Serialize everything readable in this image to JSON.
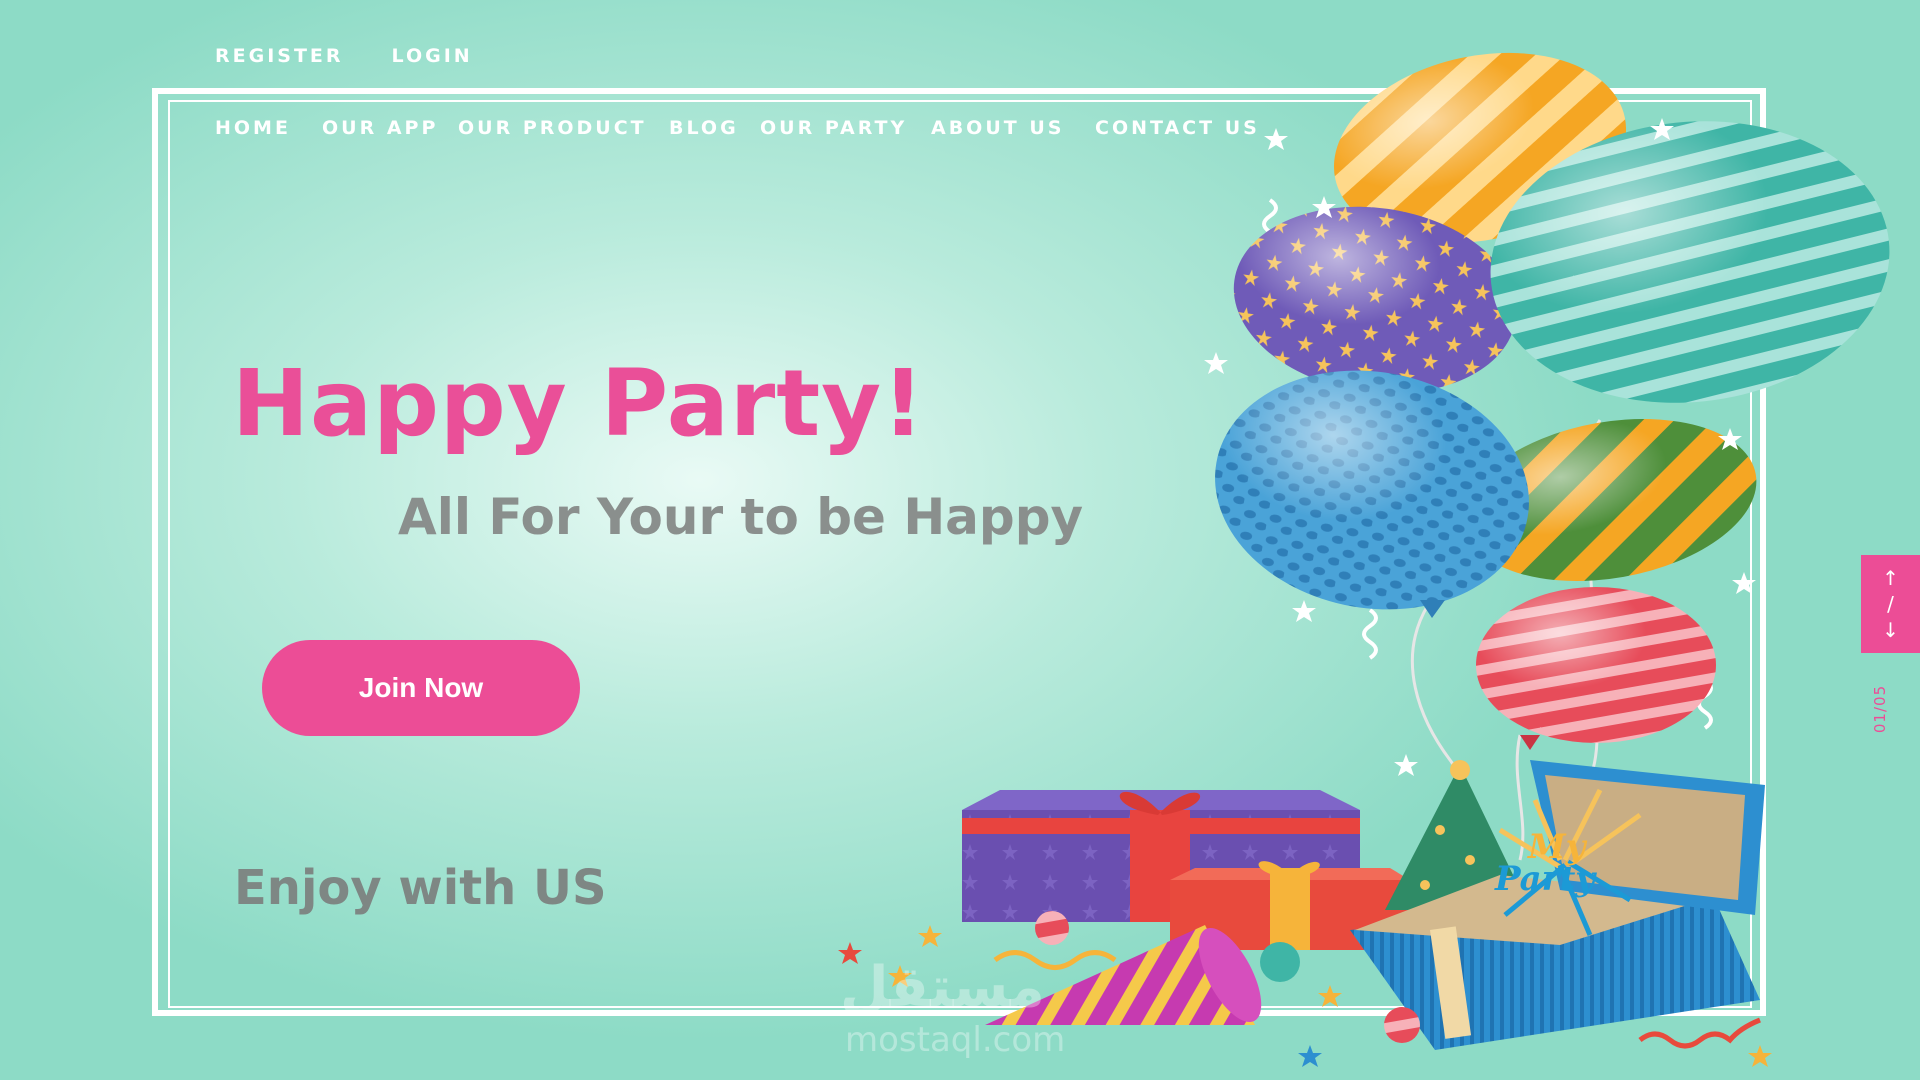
{
  "top_links": {
    "register": "REGISTER",
    "login": "LOGIN"
  },
  "nav": {
    "home": "HOME",
    "our_app": "OUR APP",
    "our_product": "OUR PRODUCT",
    "blog": "BLOG",
    "our_party": "OUR PARTY",
    "about_us": "ABOUT US",
    "contact_us": "CONTACT US"
  },
  "hero": {
    "title": "Happy Party!",
    "subtitle": "All For Your to be Happy",
    "cta": "Join Now",
    "tagline": "Enjoy with US"
  },
  "pager": {
    "up_icon": "arrow-up-icon",
    "down_icon": "arrow-down-icon",
    "count": "01/05"
  },
  "illustration": {
    "box_logo_line1": "My",
    "box_logo_line2": "Party",
    "watermark_ar": "مستقل",
    "watermark": "mostaql.com"
  },
  "colors": {
    "accent": "#ec4d96",
    "background": "#8ddbc6",
    "text_gray": "#8a8f8d",
    "white": "#ffffff"
  }
}
